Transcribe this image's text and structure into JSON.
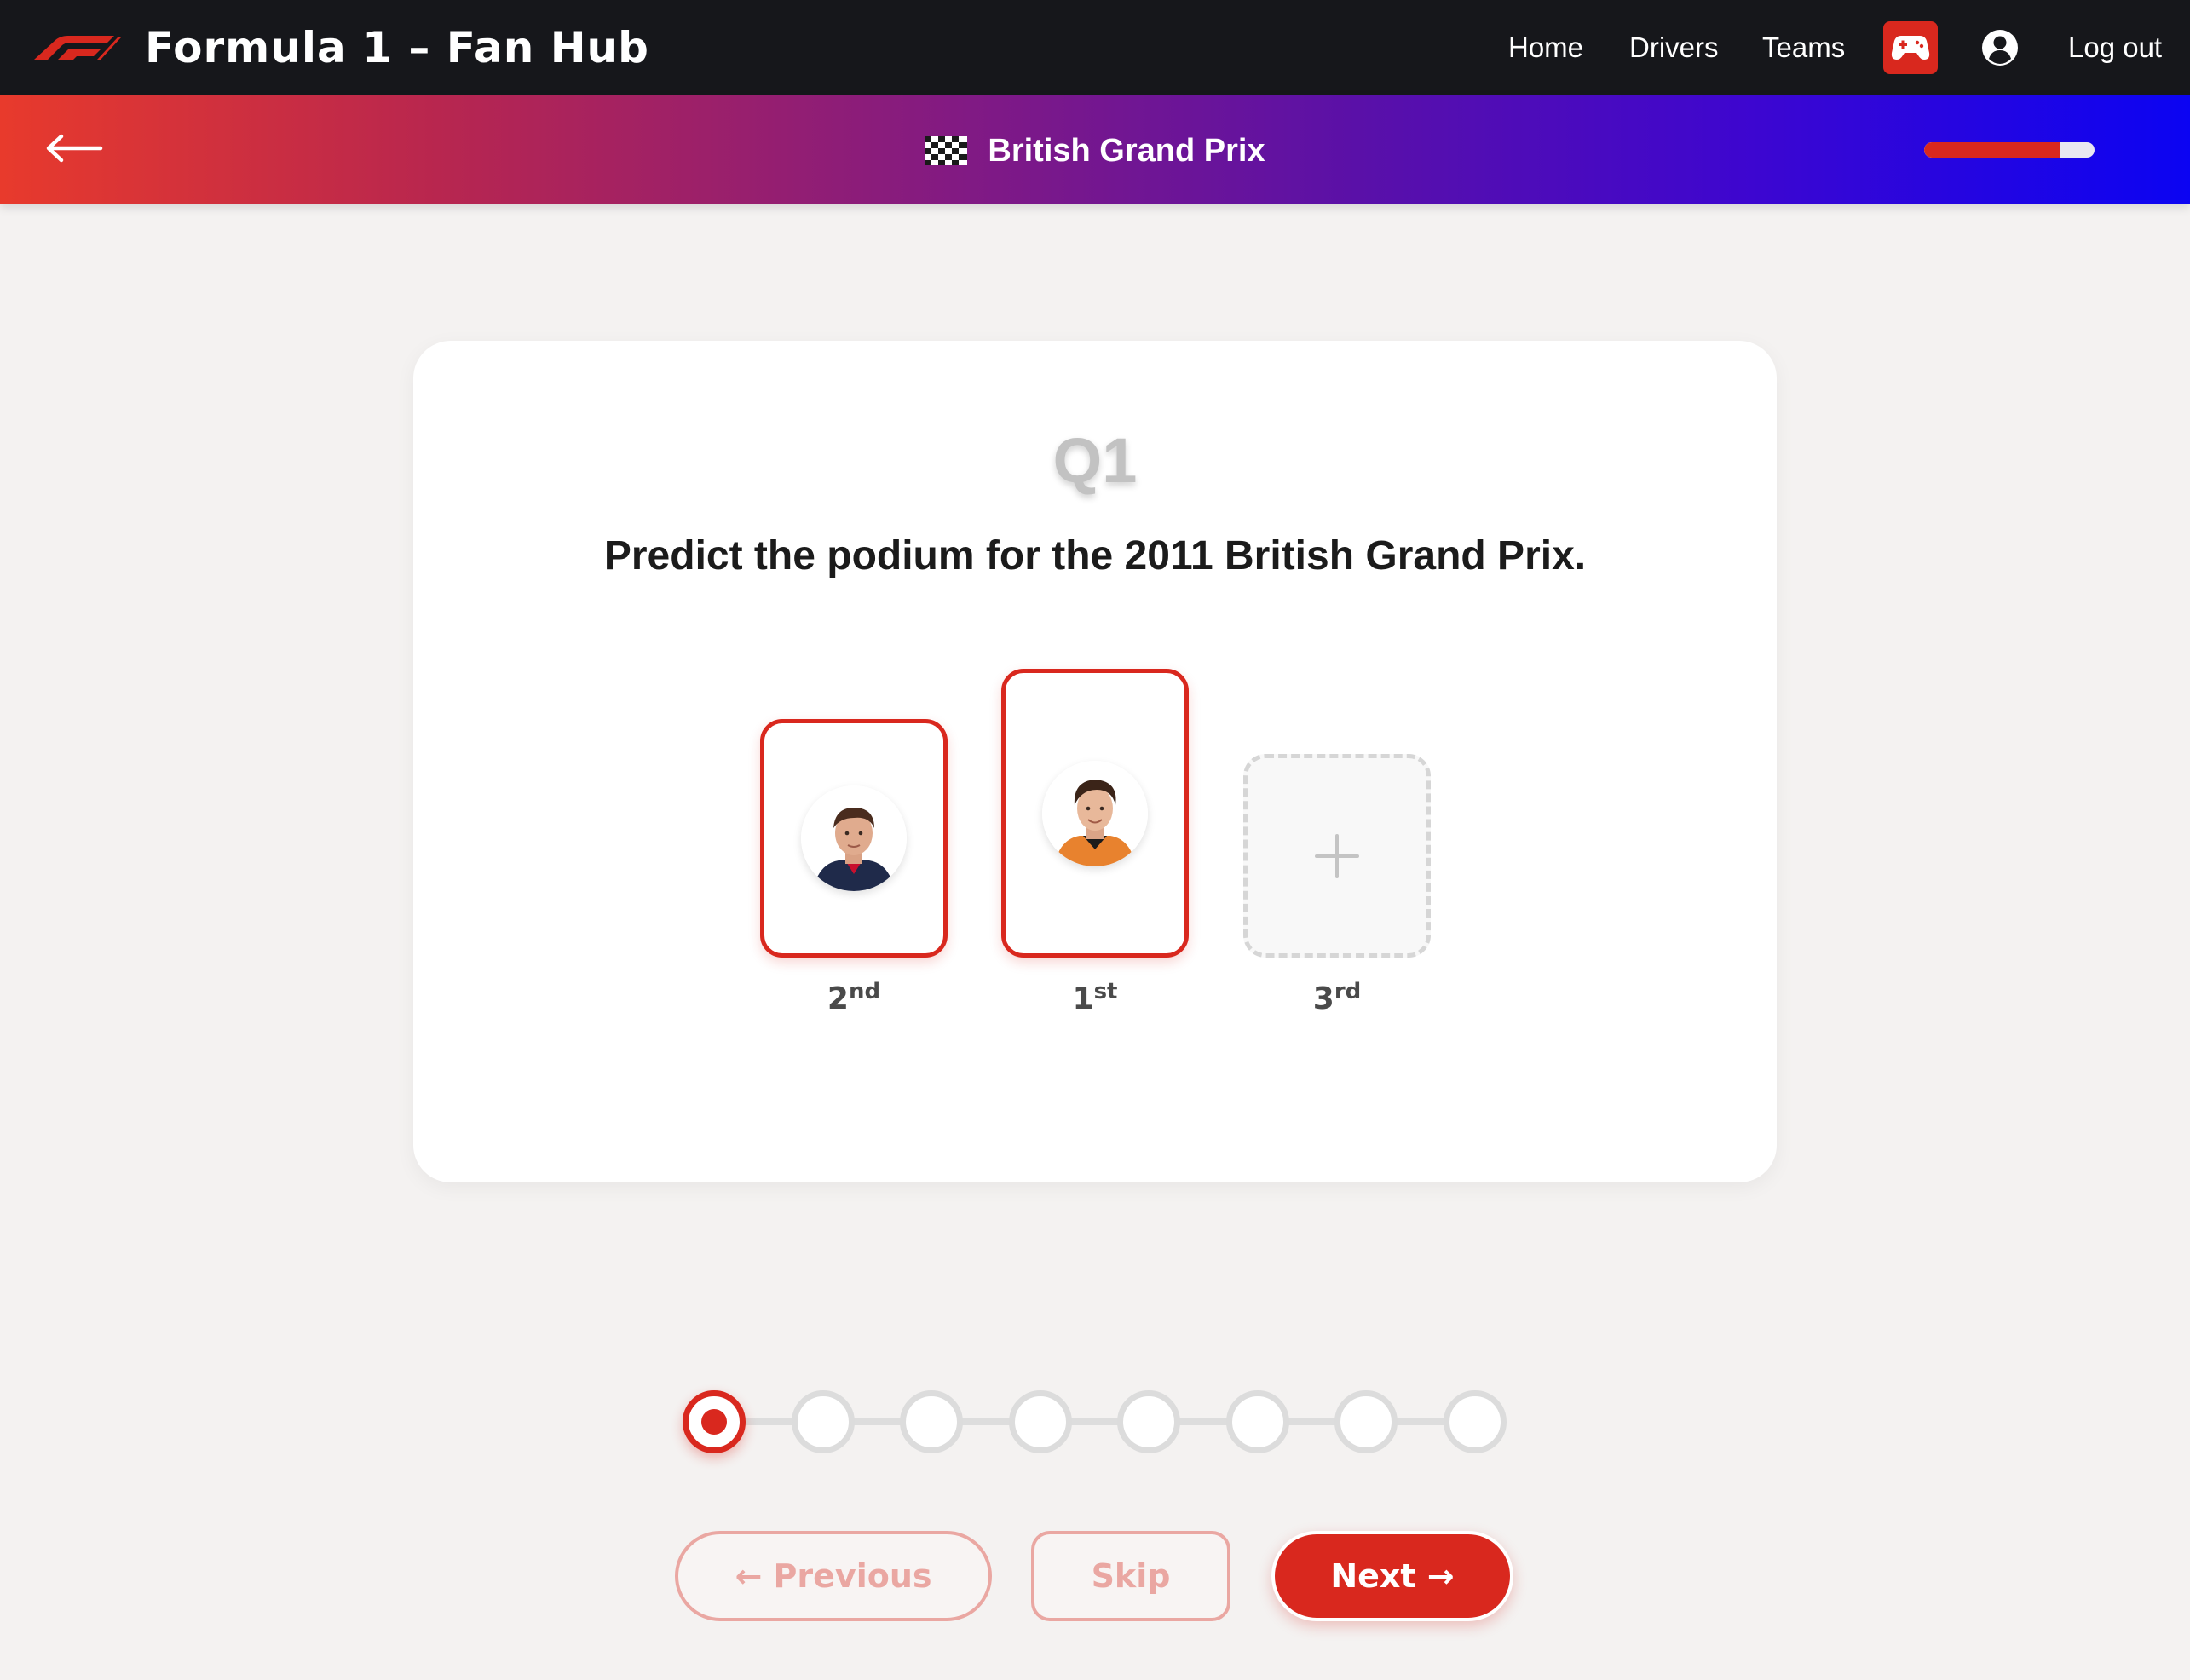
{
  "header": {
    "app_title": "Formula 1 – Fan Hub",
    "nav": {
      "home": "Home",
      "drivers": "Drivers",
      "teams": "Teams",
      "logout": "Log out"
    },
    "icons": [
      "f1-logo",
      "gamepad-icon",
      "account-icon"
    ]
  },
  "subheader": {
    "race_title": "British Grand Prix",
    "flag_icon": "checkered-flag-icon",
    "back_icon": "back-arrow-icon",
    "progress": 0.8
  },
  "question": {
    "number": "Q1",
    "text": "Predict the podium for the 2011 British Grand Prix.",
    "slots": [
      {
        "place": "2",
        "suffix": "nd",
        "state": "filled",
        "avatar": "driver-portrait-red-bull"
      },
      {
        "place": "1",
        "suffix": "st",
        "state": "filled",
        "avatar": "driver-portrait-mclaren"
      },
      {
        "place": "3",
        "suffix": "rd",
        "state": "empty",
        "icon": "plus-icon"
      }
    ]
  },
  "steps": {
    "total": 8,
    "current": 1
  },
  "buttons": {
    "previous": "← Previous",
    "skip": "Skip",
    "next": "Next →"
  },
  "colors": {
    "accent": "#d9281e",
    "navbar": "#16171b",
    "gradient_start": "#e83a2c",
    "gradient_end": "#0b04f2",
    "background": "#f4f2f1"
  }
}
